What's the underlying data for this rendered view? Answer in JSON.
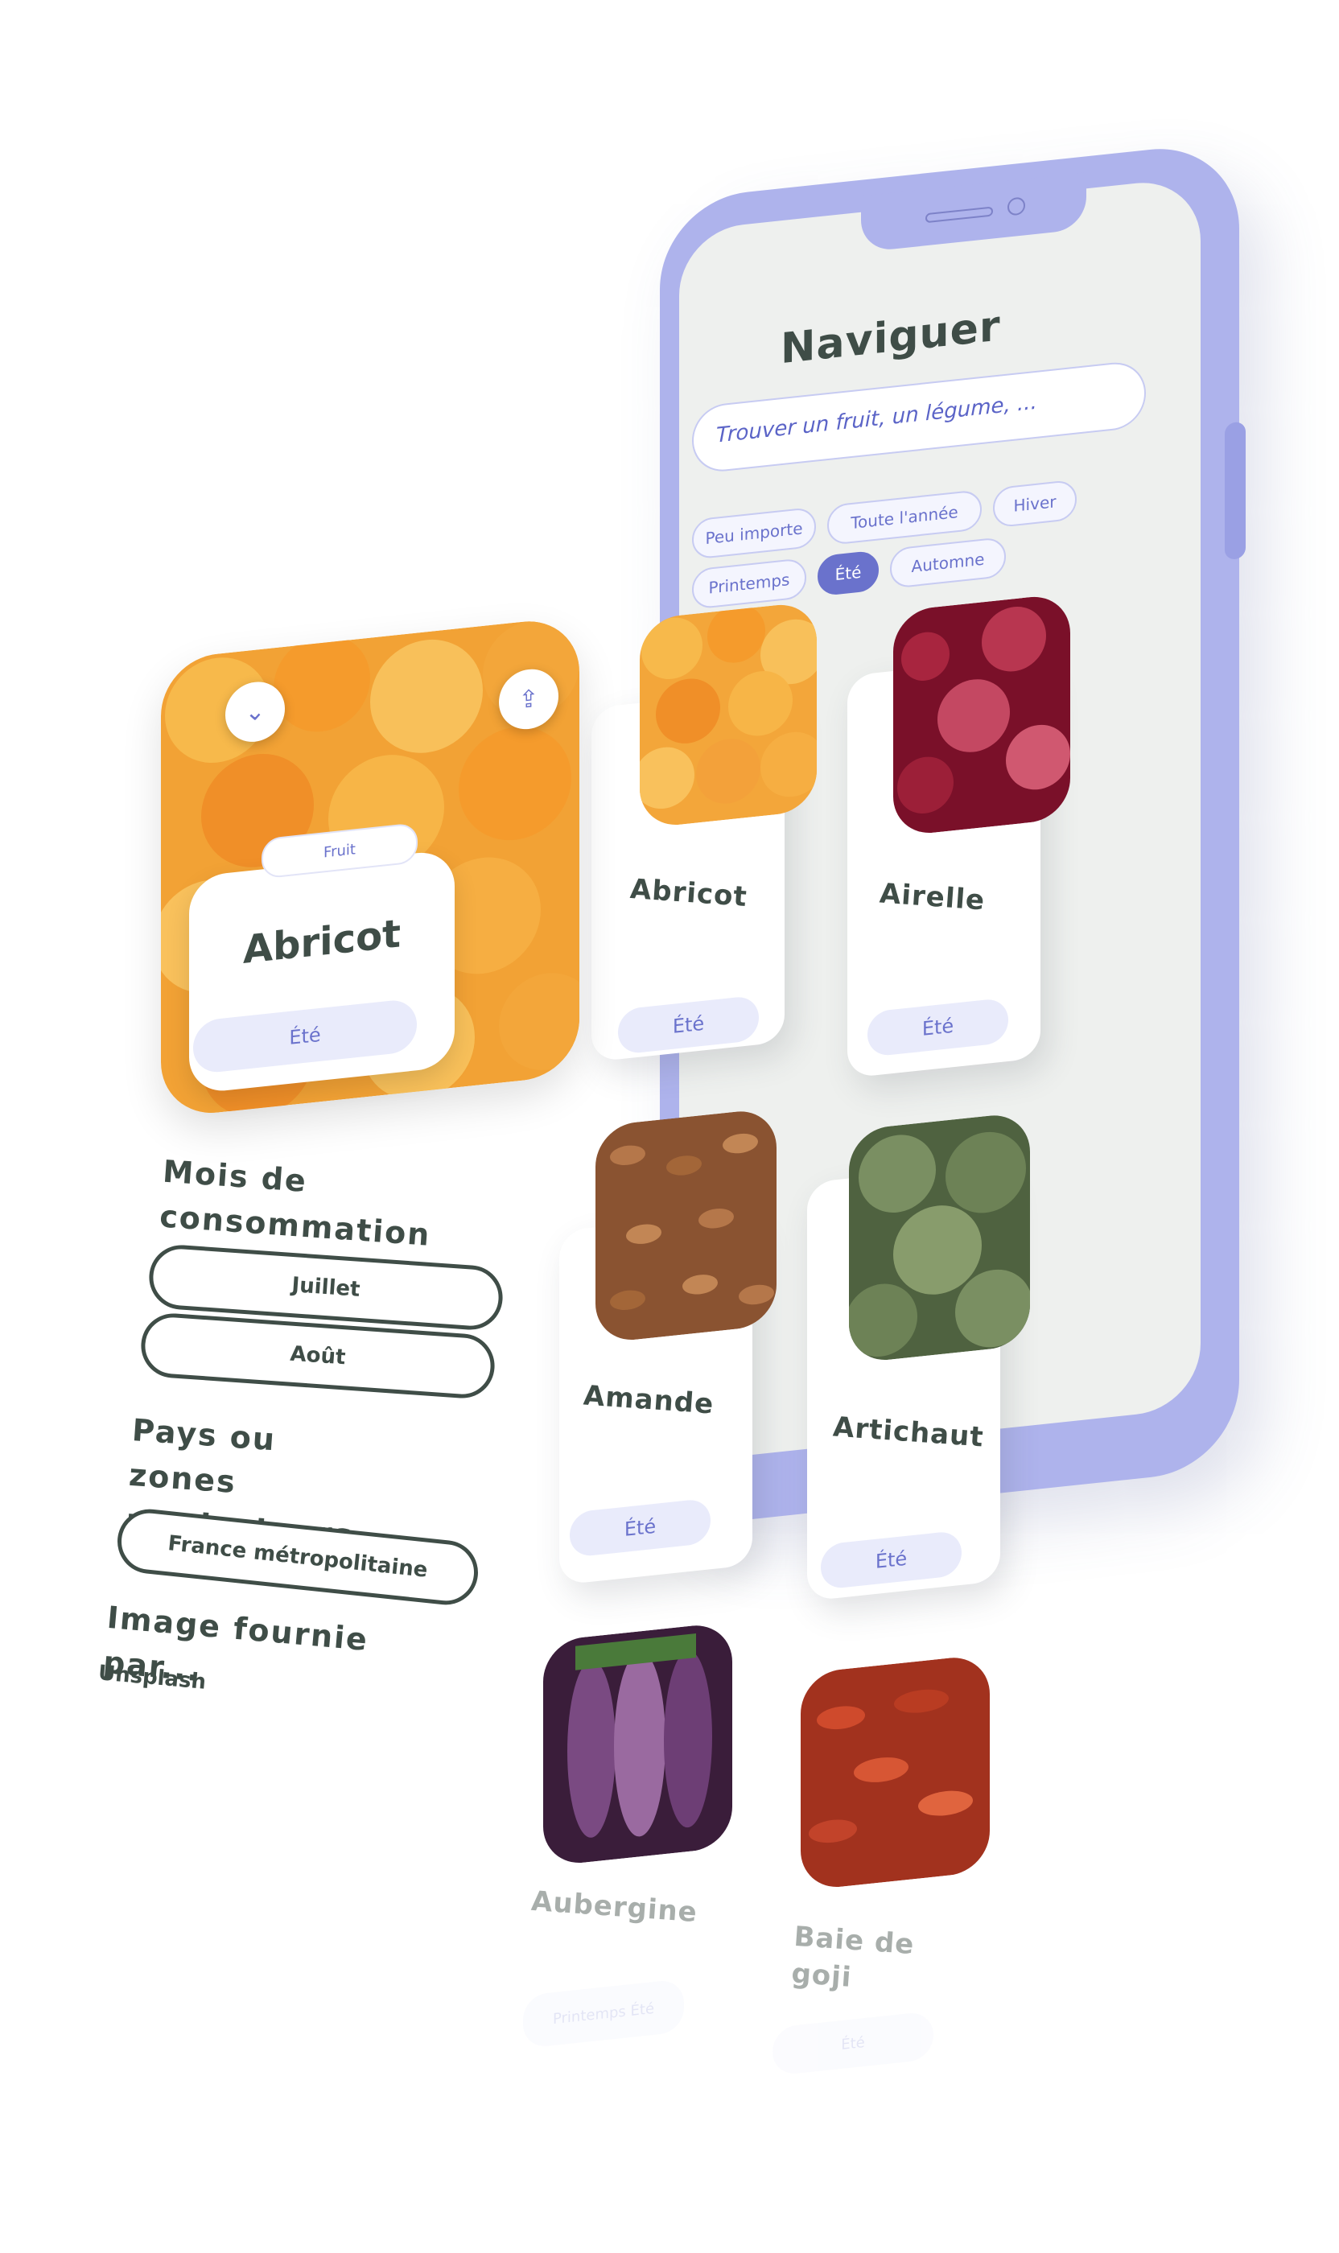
{
  "browse": {
    "title": "Naviguer",
    "search_placeholder": "Trouver un fruit, un légume, ...",
    "filters": [
      "Peu importe",
      "Toute l'année",
      "Hiver",
      "Printemps",
      "Été",
      "Automne"
    ],
    "active_filter": "Été",
    "items": [
      {
        "name": "Abricot",
        "season": "Été"
      },
      {
        "name": "Airelle",
        "season": "Été"
      },
      {
        "name": "Amande",
        "season": "Été"
      },
      {
        "name": "Artichaut",
        "season": "Été"
      },
      {
        "name": "Aubergine",
        "season": "Printemps Été"
      },
      {
        "name": "Baie de goji",
        "season": "Été"
      }
    ]
  },
  "detail": {
    "category": "Fruit",
    "name": "Abricot",
    "season": "Été",
    "months_title": "Mois de consommation",
    "months": [
      "Juillet",
      "Août"
    ],
    "countries_title": "Pays ou zones producteurs",
    "countries": [
      "France métropolitaine"
    ],
    "credit_title": "Image fournie par...",
    "credit": "Unsplash"
  },
  "colors": {
    "accent": "#6a72cc",
    "phone_body": "#aeb3ec",
    "text_dark": "#3f4d47",
    "pill_bg": "#e9ebfb"
  }
}
